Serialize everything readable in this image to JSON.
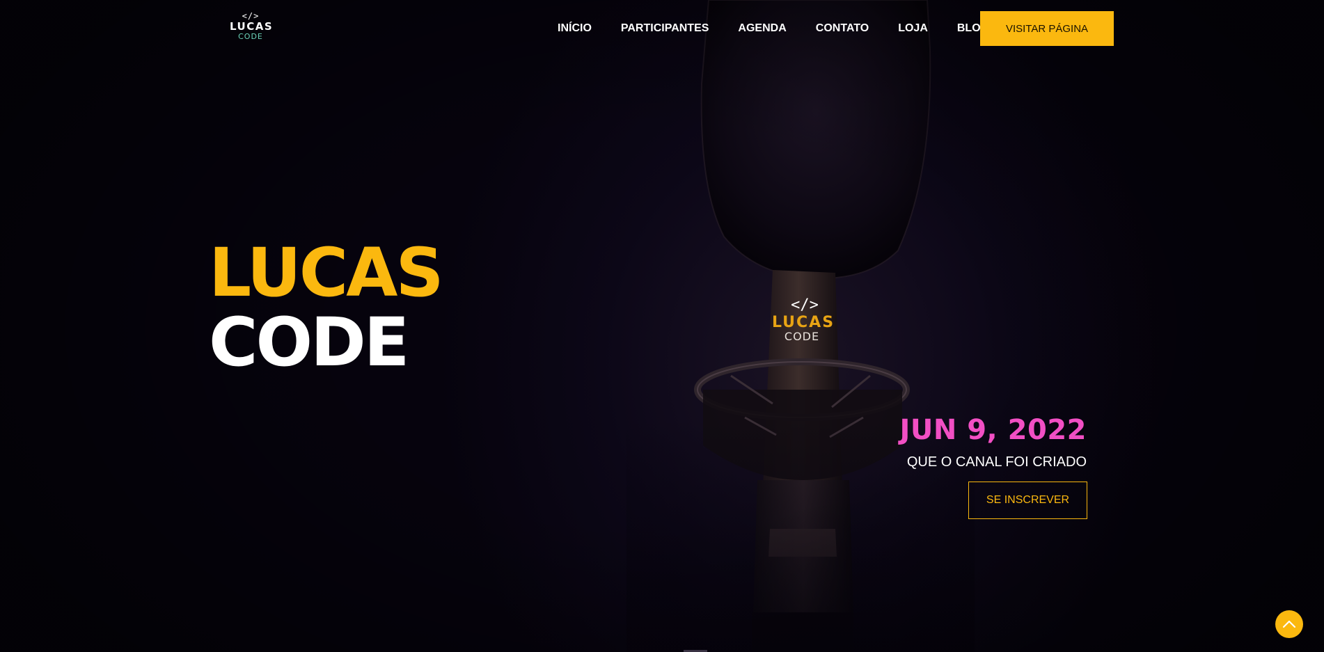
{
  "brand": {
    "logo_mark": "</>",
    "logo_top": "LUCAS",
    "logo_bottom": "CODE"
  },
  "nav": {
    "items": [
      {
        "label": "INÍCIO"
      },
      {
        "label": "PARTICIPANTES"
      },
      {
        "label": "AGENDA"
      },
      {
        "label": "CONTATO"
      },
      {
        "label": "LOJA"
      },
      {
        "label": "BLOG"
      }
    ],
    "cta_label": "VISITAR PÁGINA"
  },
  "hero": {
    "title_line1": "LUCAS",
    "title_line2": "CODE",
    "mic_logo_mark": "</>",
    "mic_logo_top": "LUCAS",
    "mic_logo_bottom": "CODE",
    "date": "JUN 9, 2022",
    "subtitle": "QUE O CANAL FOI CRIADO",
    "subscribe_label": "SE INSCREVER"
  },
  "colors": {
    "accent": "#fbb80f",
    "date": "#f24fc4",
    "background": "#07040f",
    "logo_secondary": "#6bd2b8"
  },
  "icons": {
    "scroll_top": "chevron-up-icon"
  }
}
